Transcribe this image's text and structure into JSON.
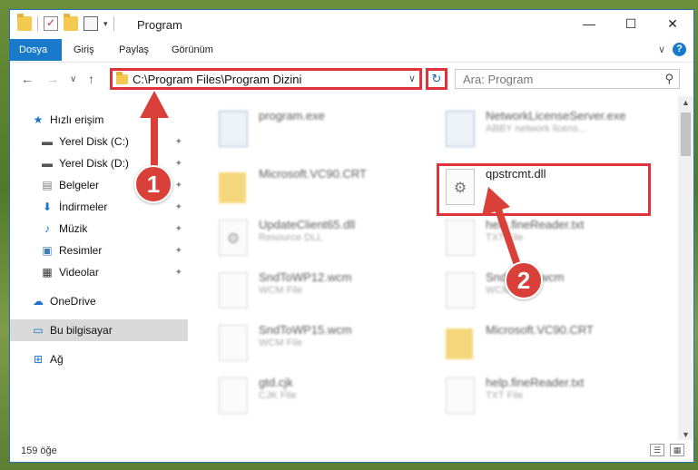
{
  "window": {
    "title": "Program",
    "controls": {
      "minimize": "—",
      "maximize": "☐",
      "close": "✕"
    }
  },
  "ribbon": {
    "tabs": [
      "Dosya",
      "Giriş",
      "Paylaş",
      "Görünüm"
    ],
    "active_tab": "Dosya",
    "expand": "∨",
    "help": "?"
  },
  "navigation": {
    "back": "←",
    "forward": "→",
    "recent": "∨",
    "up": "↑",
    "address_path": "C:\\Program Files\\Program Dizini",
    "address_dropdown": "∨",
    "refresh": "↻",
    "search_placeholder": "Ara: Program",
    "search_icon": "⚲"
  },
  "sidebar": {
    "items": [
      {
        "label": "Hızlı erişim",
        "icon": "star-icon",
        "glyph": "★",
        "color": "#1a73c9",
        "pinned": false
      },
      {
        "label": "Yerel Disk (C:)",
        "icon": "drive-icon",
        "glyph": "▬",
        "color": "#555",
        "pinned": true
      },
      {
        "label": "Yerel Disk (D:)",
        "icon": "drive-icon",
        "glyph": "▬",
        "color": "#555",
        "pinned": true
      },
      {
        "label": "Belgeler",
        "icon": "documents-icon",
        "glyph": "▤",
        "color": "#7a7a7a",
        "pinned": true
      },
      {
        "label": "İndirmeler",
        "icon": "download-icon",
        "glyph": "⬇",
        "color": "#1a73c9",
        "pinned": true
      },
      {
        "label": "Müzik",
        "icon": "music-icon",
        "glyph": "♪",
        "color": "#1a73c9",
        "pinned": true
      },
      {
        "label": "Resimler",
        "icon": "pictures-icon",
        "glyph": "▣",
        "color": "#3c7dbf",
        "pinned": true
      },
      {
        "label": "Videolar",
        "icon": "videos-icon",
        "glyph": "▦",
        "color": "#333",
        "pinned": true
      },
      {
        "label": "OneDrive",
        "icon": "onedrive-icon",
        "glyph": "☁",
        "color": "#1a73c9",
        "pinned": false
      },
      {
        "label": "Bu bilgisayar",
        "icon": "computer-icon",
        "glyph": "▭",
        "color": "#1a73c9",
        "pinned": false
      },
      {
        "label": "Ağ",
        "icon": "network-icon",
        "glyph": "⊞",
        "color": "#1a73c9",
        "pinned": false
      }
    ],
    "pin_glyph": "📌"
  },
  "files": {
    "left": [
      {
        "name": "program.exe",
        "subtitle": "",
        "type": "exe"
      },
      {
        "name": "Microsoft.VC90.CRT",
        "subtitle": "",
        "type": "folder"
      },
      {
        "name": "UpdateClient65.dll",
        "subtitle": "Resource DLL",
        "type": "dll"
      },
      {
        "name": "SndToWP12.wcm",
        "subtitle": "WCM File",
        "type": "doc"
      },
      {
        "name": "SndToWP15.wcm",
        "subtitle": "WCM File",
        "type": "doc"
      },
      {
        "name": "gtd.cjk",
        "subtitle": "CJK File",
        "type": "doc"
      }
    ],
    "right": [
      {
        "name": "NetworkLicenseServer.exe",
        "subtitle": "ABBY network licens...",
        "type": "exe"
      },
      {
        "name": "qpstrcmt.dll",
        "subtitle": "",
        "type": "dll"
      },
      {
        "name": "help.fineReader.txt",
        "subtitle": "TXT File",
        "type": "doc"
      },
      {
        "name": "SndToWP.wcm",
        "subtitle": "WCM File",
        "type": "doc"
      },
      {
        "name": "Microsoft.VC90.CRT",
        "subtitle": "",
        "type": "folder"
      },
      {
        "name": "help.fineReader.txt",
        "subtitle": "TXT File",
        "type": "doc"
      }
    ]
  },
  "status": {
    "count": "159 öğe",
    "view_details": "☰",
    "view_icons": "▦"
  },
  "annotations": {
    "marker1": "1",
    "marker2": "2"
  },
  "colors": {
    "accent": "#1979ca",
    "highlight": "#e1323c",
    "marker": "#d9403a",
    "selected": "#d9d9d9"
  }
}
